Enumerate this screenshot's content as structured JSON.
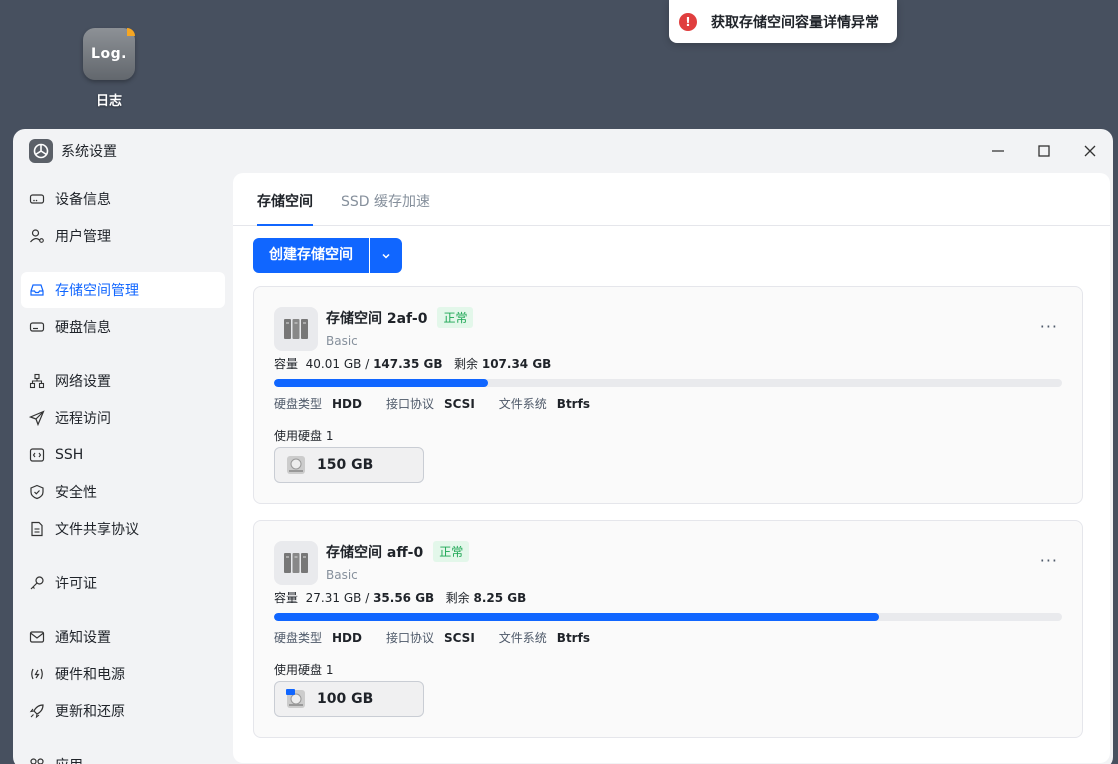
{
  "desktop": {
    "icon_text": "Log.",
    "icon_label": "日志"
  },
  "toast": {
    "message": "获取存储空间容量详情异常",
    "icon": "error-icon"
  },
  "window": {
    "title": "系统设置",
    "controls": [
      "minimize",
      "maximize",
      "close"
    ]
  },
  "sidebar": {
    "items": [
      {
        "label": "设备信息",
        "icon": "device-icon"
      },
      {
        "label": "用户管理",
        "icon": "user-icon"
      },
      {
        "label": "存储空间管理",
        "icon": "storage-icon",
        "active": true
      },
      {
        "label": "硬盘信息",
        "icon": "disk-icon"
      },
      {
        "label": "网络设置",
        "icon": "network-icon"
      },
      {
        "label": "远程访问",
        "icon": "send-icon"
      },
      {
        "label": "SSH",
        "icon": "ssh-icon"
      },
      {
        "label": "安全性",
        "icon": "shield-icon"
      },
      {
        "label": "文件共享协议",
        "icon": "file-icon"
      },
      {
        "label": "许可证",
        "icon": "key-icon"
      },
      {
        "label": "通知设置",
        "icon": "mail-icon"
      },
      {
        "label": "硬件和电源",
        "icon": "power-icon"
      },
      {
        "label": "更新和还原",
        "icon": "rocket-icon"
      },
      {
        "label": "应用",
        "icon": "apps-icon"
      }
    ]
  },
  "tabs": [
    {
      "label": "存储空间",
      "active": true
    },
    {
      "label": "SSD 缓存加速",
      "active": false
    }
  ],
  "create_button": {
    "label": "创建存储空间"
  },
  "pools": [
    {
      "name": "存储空间 2af-0",
      "status": "正常",
      "type": "Basic",
      "capacity_label": "容量",
      "used": "40.01 GB",
      "sep": "/",
      "total": "147.35 GB",
      "remaining_label": "剩余",
      "remaining": "107.34 GB",
      "usage_fraction": 0.272,
      "disk_type_label": "硬盘类型",
      "disk_type": "HDD",
      "interface_label": "接口协议",
      "interface": "SCSI",
      "fs_label": "文件系统",
      "fs": "Btrfs",
      "disks_label": "使用硬盘 1",
      "disk_size": "150 GB",
      "more": "···"
    },
    {
      "name": "存储空间 aff-0",
      "status": "正常",
      "type": "Basic",
      "capacity_label": "容量",
      "used": "27.31 GB",
      "sep": "/",
      "total": "35.56 GB",
      "remaining_label": "剩余",
      "remaining": "8.25 GB",
      "usage_fraction": 0.768,
      "disk_type_label": "硬盘类型",
      "disk_type": "HDD",
      "interface_label": "接口协议",
      "interface": "SCSI",
      "fs_label": "文件系统",
      "fs": "Btrfs",
      "disks_label": "使用硬盘 1",
      "disk_size": "100 GB",
      "more": "···"
    }
  ],
  "colors": {
    "accent": "#1066ff",
    "success": "#1ba653",
    "error": "#e03e3e",
    "desktop_bg": "#47505f"
  }
}
